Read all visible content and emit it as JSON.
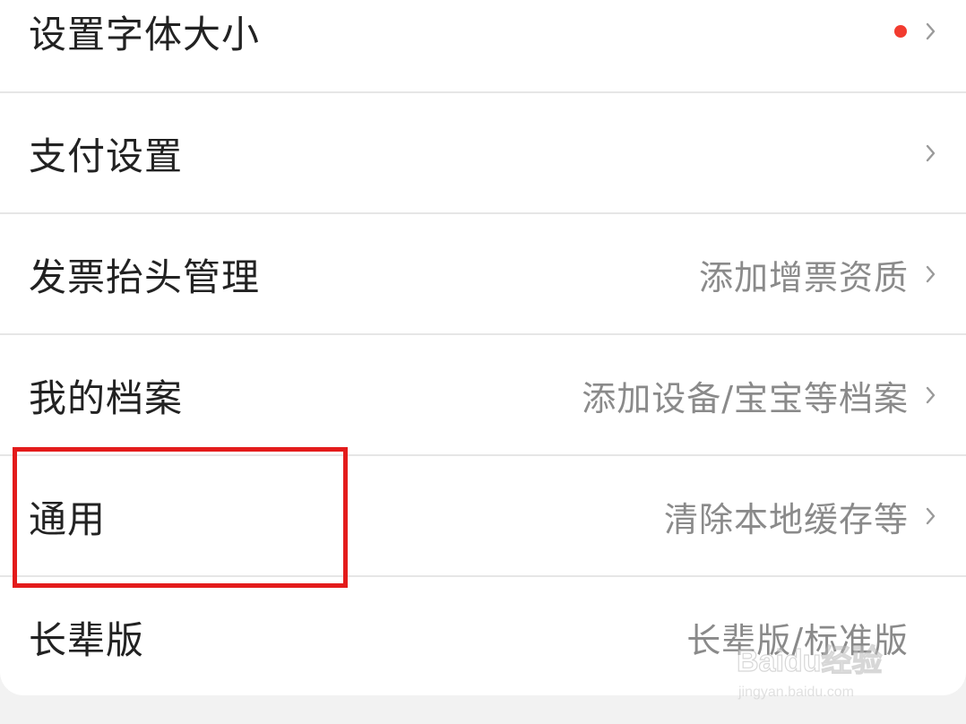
{
  "rows": [
    {
      "label": "设置字体大小",
      "hint": "",
      "has_dot": true
    },
    {
      "label": "支付设置",
      "hint": ""
    },
    {
      "label": "发票抬头管理",
      "hint": "添加增票资质"
    },
    {
      "label": "我的档案",
      "hint": "添加设备/宝宝等档案"
    },
    {
      "label": "通用",
      "hint": "清除本地缓存等"
    },
    {
      "label": "长辈版",
      "hint": "长辈版/标准版"
    }
  ],
  "watermark": {
    "brand": "Baidu经验",
    "url": "jingyan.baidu.com"
  },
  "colors": {
    "highlight_border": "#e31b1b",
    "notification_dot": "#f23b2f",
    "hint_text": "#8a8a8a",
    "label_text": "#222222"
  }
}
